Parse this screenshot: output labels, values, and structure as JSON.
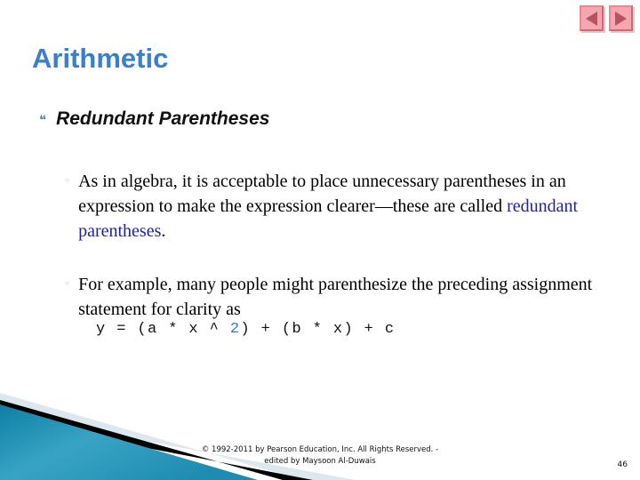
{
  "slide": {
    "title": "Arithmetic",
    "title_color": "#3b7ed0",
    "page_number": "46"
  },
  "nav": {
    "prev_label": "◀",
    "next_label": "▶",
    "button_color": "#f5a6ae",
    "arrow_color": "#b5545e"
  },
  "content": {
    "heading": {
      "marker": "❝",
      "text": "Redundant Parentheses"
    },
    "bullets": [
      {
        "marker": "◦",
        "text_before": "As in algebra, it is acceptable to place unnecessary parentheses in an expression to make the expression clearer—these are called ",
        "highlight": "redundant parentheses",
        "highlight_color": "#22229c",
        "text_after": "."
      },
      {
        "marker": "◦",
        "text_before": "For example, many people might parenthesize the preceding assignment statement for clarity as",
        "highlight": "",
        "text_after": ""
      }
    ],
    "code": {
      "prefix": "y = (a * x ^ ",
      "exponent": "2",
      "exponent_color": "#2b7fd0",
      "suffix": ") + (b * x) + c"
    }
  },
  "footer": {
    "line1": "© 1992-2011 by Pearson Education, Inc. All Rights Reserved. -",
    "line2": "edited by Maysoon Al-Duwais"
  },
  "decor": {
    "teal_light": "#39a3c4",
    "teal_dark": "#0d7fa3",
    "stripe_black": "#000000",
    "band_light": "#dce8ef"
  }
}
